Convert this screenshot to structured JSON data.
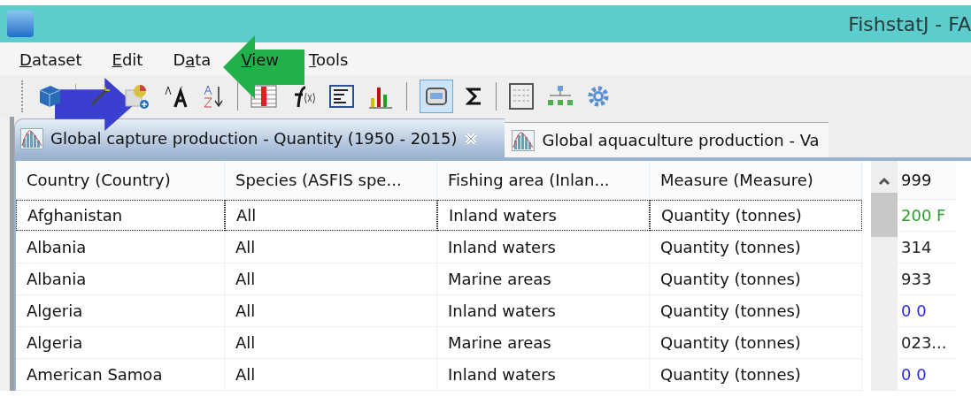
{
  "window": {
    "title": "FishstatJ - FA"
  },
  "menu": [
    {
      "parts": [
        {
          "text": "D",
          "underline": true
        },
        {
          "text": "ataset",
          "underline": false
        }
      ]
    },
    {
      "parts": [
        {
          "text": "E",
          "underline": true
        },
        {
          "text": "dit",
          "underline": false
        }
      ]
    },
    {
      "parts": [
        {
          "text": "D",
          "underline": false
        },
        {
          "text": "a",
          "underline": true
        },
        {
          "text": "ta",
          "underline": false
        }
      ]
    },
    {
      "parts": [
        {
          "text": "V",
          "underline": true
        },
        {
          "text": "iew",
          "underline": false
        }
      ]
    },
    {
      "parts": [
        {
          "text": "T",
          "underline": true
        },
        {
          "text": "ools",
          "underline": false
        }
      ]
    }
  ],
  "toolbar": {
    "view_toggle_on": true
  },
  "tabs": [
    {
      "label": "Global capture production - Quantity (1950 - 2015)",
      "selected": true
    },
    {
      "label": "Global aquaculture production - Va",
      "selected": false
    }
  ],
  "table": {
    "columns": [
      "Country (Country)",
      "Species (ASFIS spe...",
      "Fishing area (Inlan...",
      "Measure (Measure)",
      "999"
    ],
    "rows": [
      {
        "selected": true,
        "cells": [
          "Afghanistan",
          "All",
          "Inland waters",
          "Quantity (tonnes)"
        ],
        "value": {
          "text": "200 F",
          "color": "#2e9e2e"
        }
      },
      {
        "selected": false,
        "cells": [
          "Albania",
          "All",
          "Inland waters",
          "Quantity (tonnes)"
        ],
        "value": {
          "text": "314",
          "color": "#222222"
        }
      },
      {
        "selected": false,
        "cells": [
          "Albania",
          "All",
          "Marine areas",
          "Quantity (tonnes)"
        ],
        "value": {
          "text": "933",
          "color": "#222222"
        }
      },
      {
        "selected": false,
        "cells": [
          "Algeria",
          "All",
          "Inland waters",
          "Quantity (tonnes)"
        ],
        "value": {
          "text": "0 0",
          "color": "#2a2ae0"
        }
      },
      {
        "selected": false,
        "cells": [
          "Algeria",
          "All",
          "Marine areas",
          "Quantity (tonnes)"
        ],
        "value": {
          "text": "023...",
          "color": "#222222"
        }
      },
      {
        "selected": false,
        "cells": [
          "American Samoa",
          "All",
          "Inland waters",
          "Quantity (tonnes)"
        ],
        "value": {
          "text": "0 0",
          "color": "#2a2ae0"
        }
      }
    ]
  }
}
